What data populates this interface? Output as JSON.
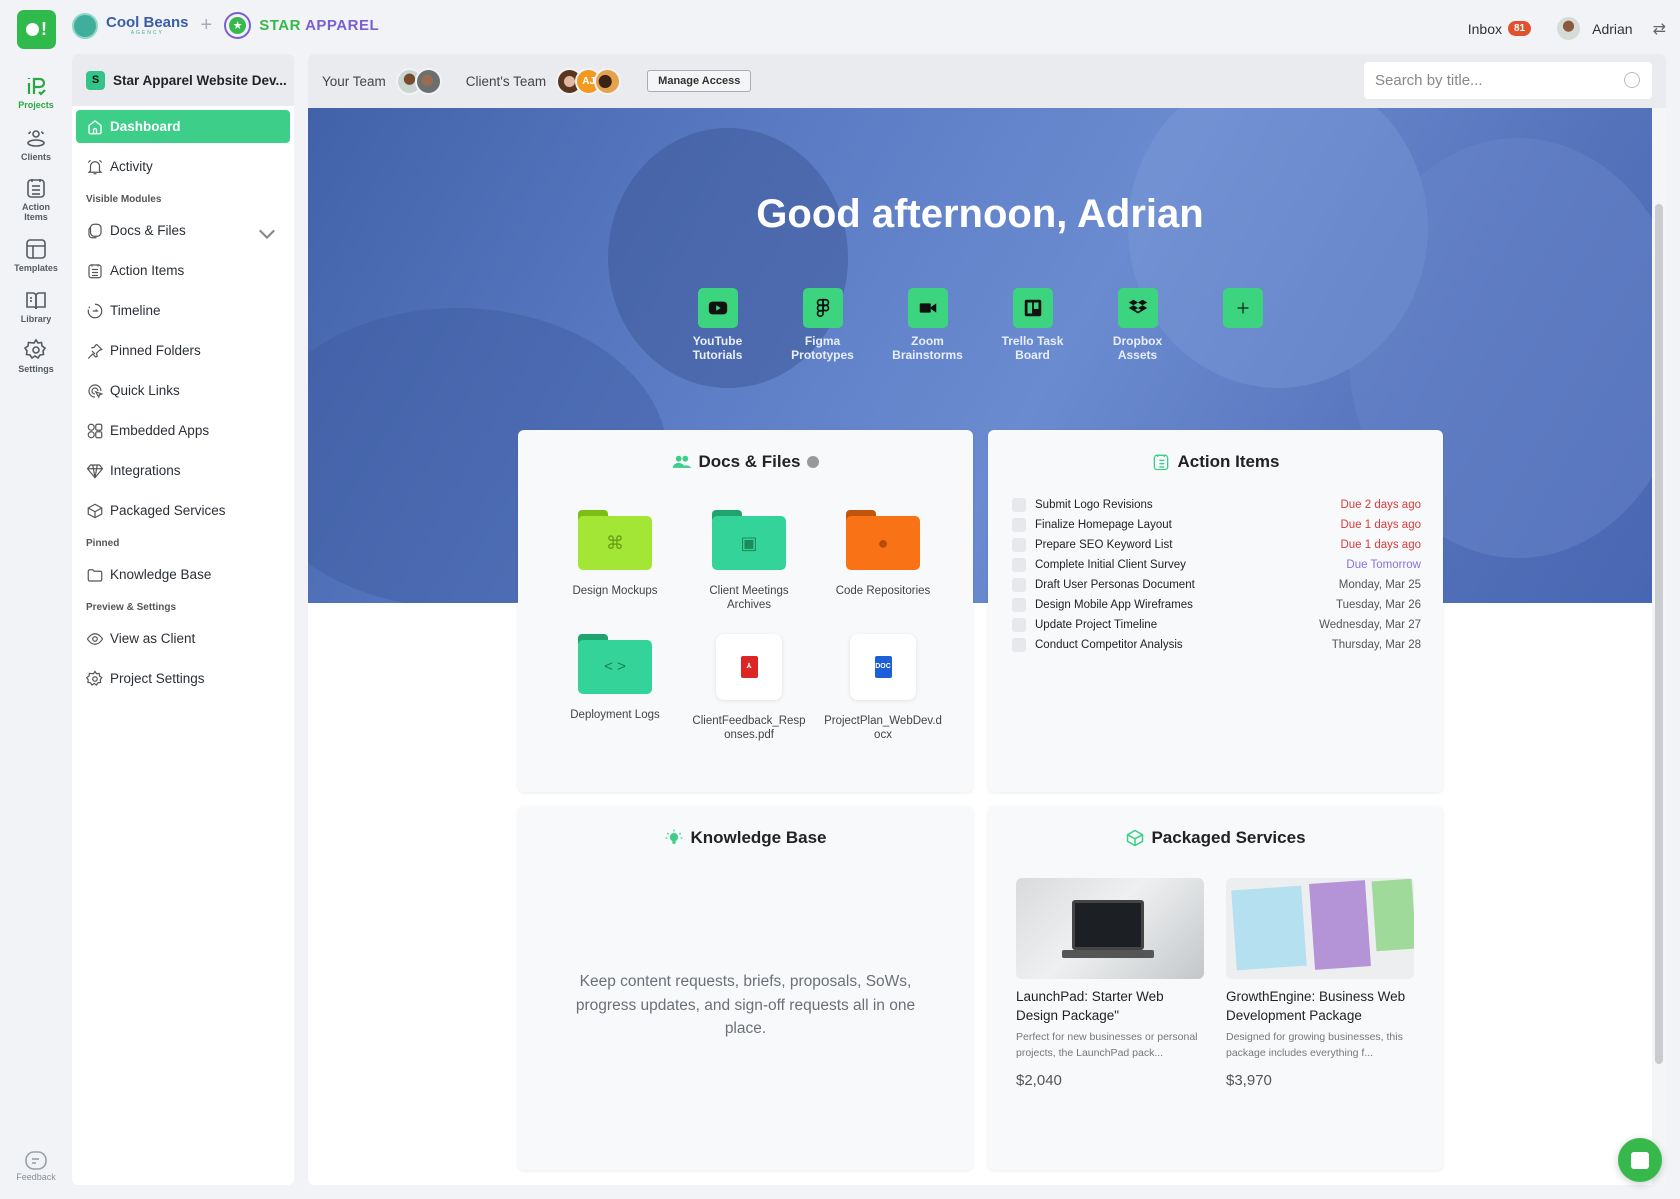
{
  "rail": {
    "items": [
      {
        "label": "Projects",
        "icon": "projects-icon"
      },
      {
        "label": "Clients",
        "icon": "clients-icon"
      },
      {
        "label": "Action Items",
        "icon": "action-items-icon"
      },
      {
        "label": "Templates",
        "icon": "templates-icon"
      },
      {
        "label": "Library",
        "icon": "library-icon"
      },
      {
        "label": "Settings",
        "icon": "gear-icon"
      }
    ],
    "feedback_label": "Feedback",
    "logo_text": "!"
  },
  "brand": {
    "agency_name": "Cool Beans",
    "agency_sub": "AGENCY",
    "separator": "+",
    "client_name_part1": "STAR",
    "client_name_part2": "APPAREL",
    "client_star": "★"
  },
  "top_right": {
    "inbox_label": "Inbox",
    "inbox_count": "81",
    "user_name": "Adrian",
    "swap_icon": "⇄"
  },
  "project": {
    "initial": "S",
    "name": "Star Apparel Website Dev..."
  },
  "nav": {
    "dashboard": "Dashboard",
    "activity": "Activity",
    "section_modules": "Visible Modules",
    "modules": [
      "Docs & Files",
      "Action Items",
      "Timeline",
      "Pinned Folders",
      "Quick Links",
      "Embedded Apps",
      "Integrations",
      "Packaged Services"
    ],
    "section_pinned": "Pinned",
    "pinned": [
      "Knowledge Base"
    ],
    "section_preview": "Preview & Settings",
    "preview": [
      "View as Client",
      "Project Settings"
    ]
  },
  "teambar": {
    "your_team_label": "Your Team",
    "clients_team_label": "Client's Team",
    "client_initials": "AJ",
    "manage_access_label": "Manage Access",
    "search_placeholder": "Search by title..."
  },
  "hero": {
    "greeting": "Good afternoon, Adrian",
    "apps": [
      {
        "label_line1": "YouTube",
        "label_line2": "Tutorials",
        "icon": "youtube-icon"
      },
      {
        "label_line1": "Figma",
        "label_line2": "Prototypes",
        "icon": "figma-icon"
      },
      {
        "label_line1": "Zoom",
        "label_line2": "Brainstorms",
        "icon": "zoom-video-icon"
      },
      {
        "label_line1": "Trello Task",
        "label_line2": "Board",
        "icon": "trello-icon"
      },
      {
        "label_line1": "Dropbox",
        "label_line2": "Assets",
        "icon": "dropbox-icon"
      },
      {
        "label_line1": "",
        "label_line2": "",
        "icon": "plus-icon"
      }
    ]
  },
  "docs_files": {
    "title": "Docs & Files",
    "items": [
      {
        "name": "Design Mockups",
        "type": "folder",
        "color": "#a3e635",
        "icon": "figma-icon"
      },
      {
        "name": "Client Meetings Archives",
        "type": "folder",
        "color": "#34d399",
        "icon": "archive-icon"
      },
      {
        "name": "Code Repositories",
        "type": "folder",
        "color": "#f97316",
        "icon": "github-icon"
      },
      {
        "name": "Deployment Logs",
        "type": "folder",
        "color": "#34d399",
        "icon": "code-icon"
      },
      {
        "name": "ClientFeedback_Responses.pdf",
        "type": "pdf",
        "color": "#dc2626",
        "icon": "pdf-icon"
      },
      {
        "name": "ProjectPlan_WebDev.docx",
        "type": "doc",
        "color": "#1d5fd6",
        "icon": "doc-icon"
      }
    ]
  },
  "action_items": {
    "title": "Action Items",
    "items": [
      {
        "task": "Submit Logo Revisions",
        "due": "Due 2 days ago",
        "status": "overdue"
      },
      {
        "task": "Finalize Homepage Layout",
        "due": "Due 1 days ago",
        "status": "overdue"
      },
      {
        "task": "Prepare SEO Keyword List",
        "due": "Due 1 days ago",
        "status": "overdue"
      },
      {
        "task": "Complete Initial Client Survey",
        "due": "Due Tomorrow",
        "status": "soon"
      },
      {
        "task": "Draft User Personas Document",
        "due": "Monday, Mar 25",
        "status": "normal"
      },
      {
        "task": "Design Mobile App Wireframes",
        "due": "Tuesday, Mar 26",
        "status": "normal"
      },
      {
        "task": "Update Project Timeline",
        "due": "Wednesday, Mar 27",
        "status": "normal"
      },
      {
        "task": "Conduct Competitor Analysis",
        "due": "Thursday, Mar 28",
        "status": "normal"
      }
    ],
    "colors": {
      "overdue": "#d93b3b",
      "soon": "#8b6fd6",
      "normal": "#555555"
    }
  },
  "knowledge_base": {
    "title": "Knowledge Base",
    "description": "Keep content requests, briefs, proposals, SoWs, progress updates, and sign-off requests all in one place."
  },
  "packaged_services": {
    "title": "Packaged Services",
    "items": [
      {
        "name": "LaunchPad: Starter Web Design Package\"",
        "description": "Perfect for new businesses or personal projects, the LaunchPad pack...",
        "price": "$2,040"
      },
      {
        "name": "GrowthEngine: Business Web Development Package",
        "description": "Designed for growing businesses, this package includes everything f...",
        "price": "$3,970"
      }
    ]
  },
  "colors": {
    "accent_green": "#3dcf8a",
    "brand_green": "#2fba4b",
    "hero_blue": "#5272bd",
    "badge_red": "#e0522c"
  }
}
